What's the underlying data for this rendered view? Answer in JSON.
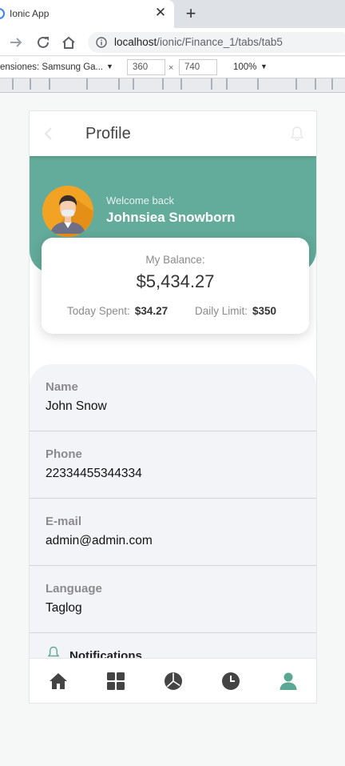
{
  "browser": {
    "tab_title": "Ionic App",
    "new_tab": "+",
    "close": "✕",
    "url_host": "localhost",
    "url_path": "/ionic/Finance_1/tabs/tab5",
    "device": "ensiones: Samsung Ga...",
    "width": "360",
    "height": "740",
    "x": "×",
    "zoom": "100%",
    "dropdown": "▼"
  },
  "header": {
    "title": "Profile"
  },
  "hero": {
    "welcome": "Welcome back",
    "name": "Johnsiea Snowborn"
  },
  "balance": {
    "label": "My Balance:",
    "value": "$5,434.27",
    "today_label": "Today Spent:",
    "today_value": "$34.27",
    "limit_label": "Daily Limit:",
    "limit_value": "$350"
  },
  "info": [
    {
      "label": "Name",
      "value": "John Snow"
    },
    {
      "label": "Phone",
      "value": "22334455344334"
    },
    {
      "label": "E-mail",
      "value": "admin@admin.com"
    },
    {
      "label": "Language",
      "value": "Taglog"
    }
  ],
  "notifications": {
    "label": "Notifications"
  },
  "colors": {
    "accent": "#63ab9a",
    "tab_active": "#5aa796",
    "tab_inactive": "#444444"
  },
  "tabs": [
    {
      "icon": "home-icon"
    },
    {
      "icon": "grid-icon"
    },
    {
      "icon": "pie-chart-icon"
    },
    {
      "icon": "clock-icon"
    },
    {
      "icon": "person-icon"
    }
  ]
}
